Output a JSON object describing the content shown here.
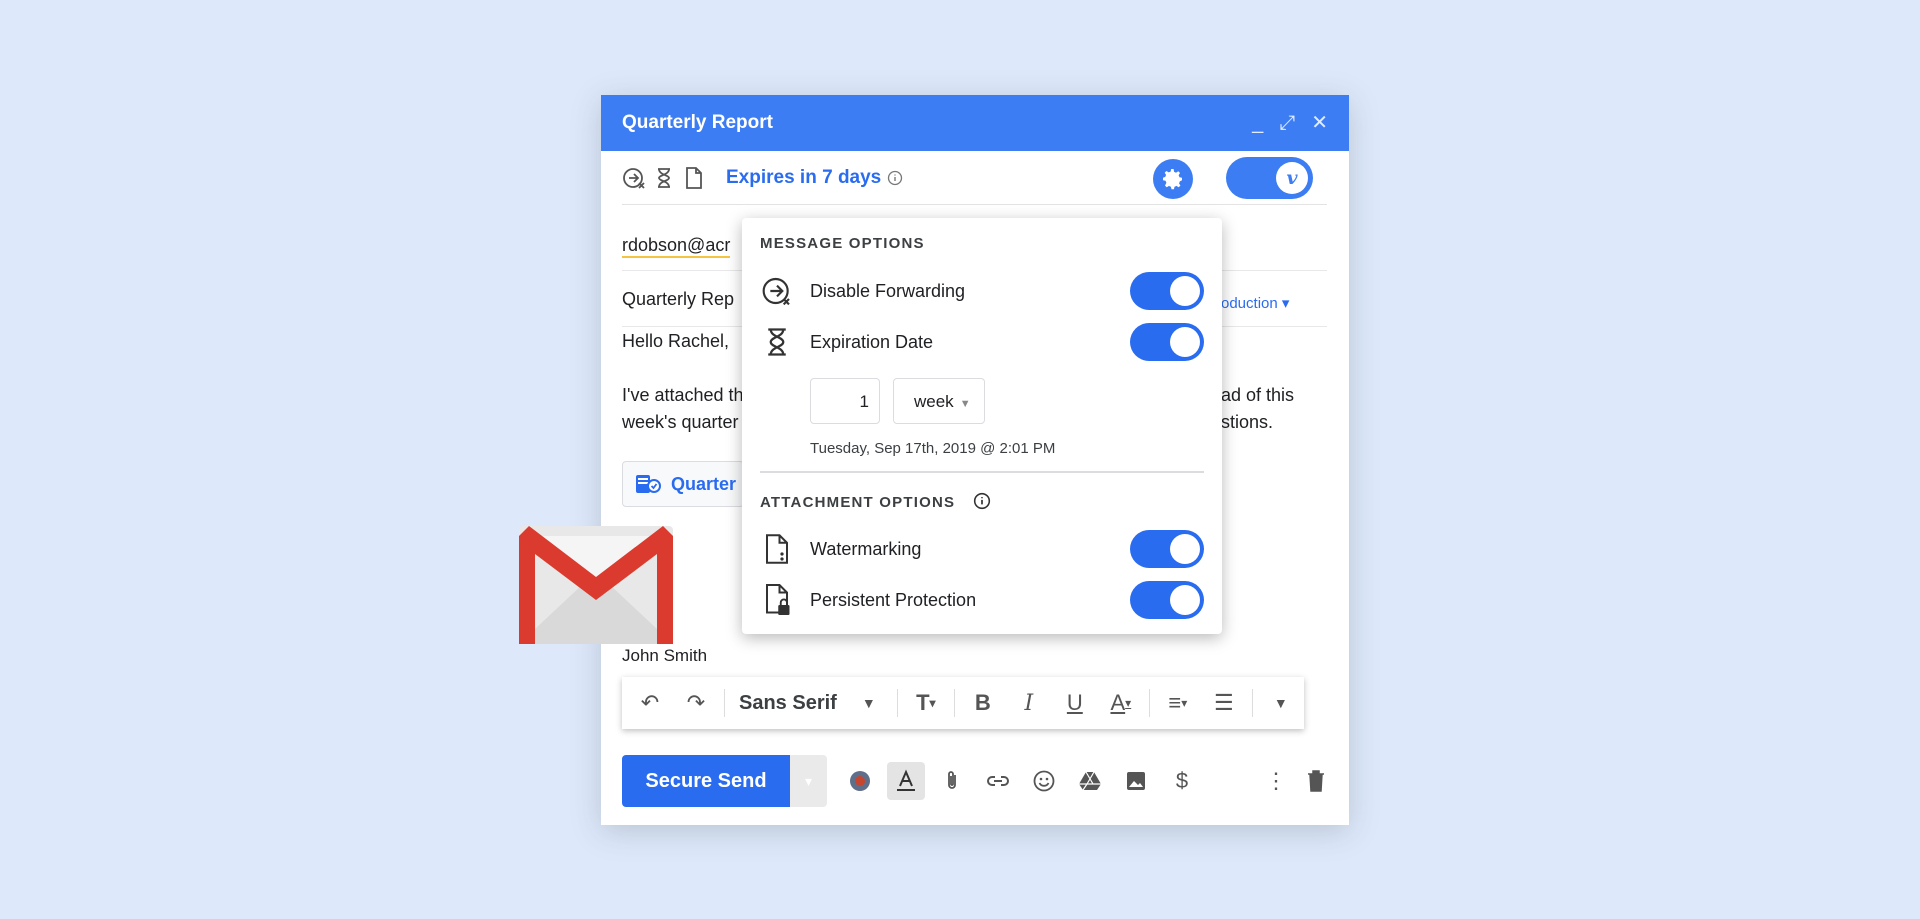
{
  "window": {
    "title": "Quarterly Report",
    "controls": [
      "minimize-icon",
      "expand-icon",
      "close-icon"
    ]
  },
  "virtru_bar": {
    "expires_label": "Expires in 7 days",
    "toggle_letter": "v"
  },
  "to_field": "rdobson@acr",
  "subject": "Quarterly Rep",
  "subject_right": "roduction ▾",
  "body": {
    "greeting": "Hello Rachel,",
    "line1_left": "I've attached th",
    "line2_left": "week's quarter",
    "line1_right": "ad of this",
    "line2_right": "stions."
  },
  "attachment": {
    "label": "Quarter"
  },
  "signature": "John Smith",
  "format_bar": {
    "font": "Sans Serif"
  },
  "send": {
    "label": "Secure Send"
  },
  "popup": {
    "message_options_title": "MESSAGE OPTIONS",
    "disable_forwarding": {
      "label": "Disable Forwarding",
      "on": true
    },
    "expiration_date": {
      "label": "Expiration Date",
      "on": true
    },
    "expiration_amount": "1",
    "expiration_unit": "week",
    "expiration_datetime": "Tuesday, Sep 17th, 2019 @ 2:01 PM",
    "attachment_options_title": "ATTACHMENT OPTIONS",
    "watermarking": {
      "label": "Watermarking",
      "on": true
    },
    "persistent_protection": {
      "label": "Persistent Protection",
      "on": true
    }
  },
  "colors": {
    "accent": "#2a6cf0",
    "titlebar": "#3d7df3",
    "background": "#dde9fb",
    "gmail_red": "#db3b2e"
  }
}
